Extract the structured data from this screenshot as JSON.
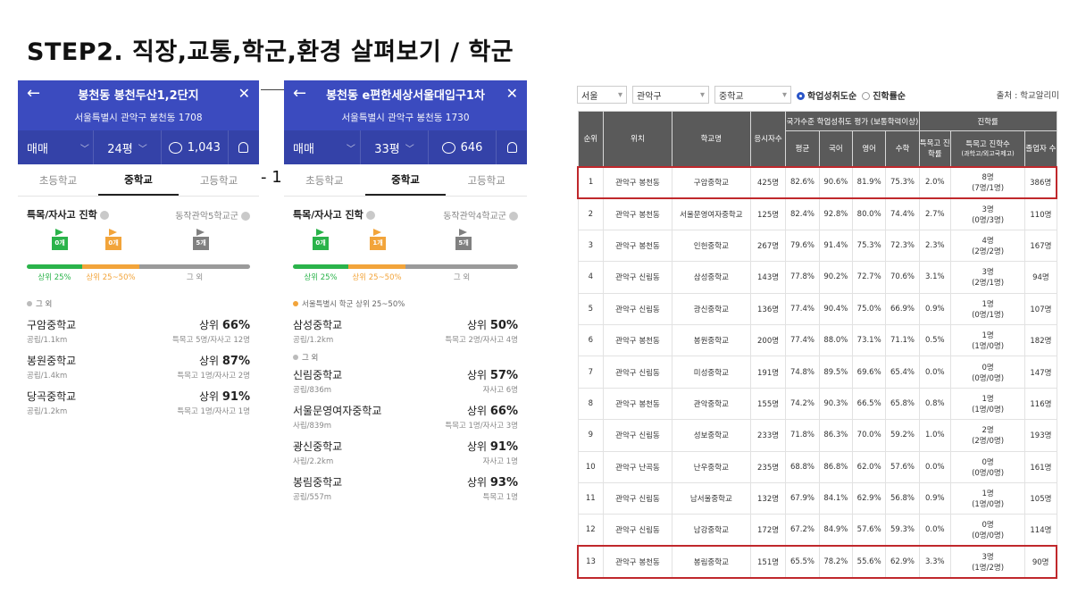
{
  "slide_title": "STEP2. 직장,교통,학군,환경 살펴보기 / 학군",
  "stray_text": "- 1",
  "panel1": {
    "title": "봉천동 봉천두산1,2단지",
    "address": "서울특별시 관악구 봉천동 1708",
    "trade": "매매",
    "size": "24평",
    "comments": "1,043",
    "tabs": [
      "초등학교",
      "중학교",
      "고등학교"
    ],
    "section_title": "특목/자사고 진학",
    "section_sub": "동작관악5학교군",
    "flags": [
      "0개",
      "0개",
      "5개"
    ],
    "bar_labels": [
      "상위 25%",
      "상위 25~50%",
      "그 외"
    ],
    "legend": "그 외",
    "schools": [
      {
        "name": "구암중학교",
        "rank_prefix": "상위",
        "rank": "66%",
        "type": "공립/1.1km",
        "detail": "특목고 5명/자사고 12명"
      },
      {
        "name": "봉원중학교",
        "rank_prefix": "상위",
        "rank": "87%",
        "type": "공립/1.4km",
        "detail": "특목고 1명/자사고 2명"
      },
      {
        "name": "당곡중학교",
        "rank_prefix": "상위",
        "rank": "91%",
        "type": "공립/1.2km",
        "detail": "특목고 1명/자사고 1명"
      }
    ]
  },
  "panel2": {
    "title": "봉천동 e편한세상서울대입구1차",
    "address": "서울특별시 관악구 봉천동 1730",
    "trade": "매매",
    "size": "33평",
    "comments": "646",
    "tabs": [
      "초등학교",
      "중학교",
      "고등학교"
    ],
    "section_title": "특목/자사고 진학",
    "section_sub": "동작관악4학교군",
    "flags": [
      "0개",
      "1개",
      "5개"
    ],
    "bar_labels": [
      "상위 25%",
      "상위 25~50%",
      "그 외"
    ],
    "legend_a": "서울특별시 학군 상위 25~50%",
    "legend_b": "그 외",
    "schools_a": [
      {
        "name": "삼성중학교",
        "rank_prefix": "상위",
        "rank": "50%",
        "type": "공립/1.2km",
        "detail": "특목고 2명/자사고 4명"
      }
    ],
    "schools_b": [
      {
        "name": "신림중학교",
        "rank_prefix": "상위",
        "rank": "57%",
        "type": "공립/836m",
        "detail": "자사고 6명"
      },
      {
        "name": "서울문영여자중학교",
        "rank_prefix": "상위",
        "rank": "66%",
        "type": "사립/839m",
        "detail": "특목고 1명/자사고 3명"
      },
      {
        "name": "광신중학교",
        "rank_prefix": "상위",
        "rank": "91%",
        "type": "사립/2.2km",
        "detail": "자사고 1명"
      },
      {
        "name": "봉림중학교",
        "rank_prefix": "상위",
        "rank": "93%",
        "type": "공립/557m",
        "detail": "특목고 1명"
      }
    ]
  },
  "filters": {
    "region": "서울",
    "district": "관악구",
    "level": "중학교",
    "radio_on": "학업성취도순",
    "radio_off": "진학률순",
    "source": "출처 : 학교알리미"
  },
  "table": {
    "h_rank": "순위",
    "h_loc": "위치",
    "h_school": "학교명",
    "h_students": "응시자수",
    "h_group1": "국가수준 학업성취도 평가 (보통학력이상)",
    "h_group2": "진학률",
    "h_avg": "평균",
    "h_kor": "국어",
    "h_eng": "영어",
    "h_math": "수학",
    "h_special_rate": "특목고 진학률",
    "h_special_cnt": "특목고 진학수",
    "h_special_cnt_sub": "(과학고/외고국제고)",
    "h_grads": "졸업자 수",
    "rows": [
      {
        "rank": "1",
        "loc": "관악구 봉천동",
        "school": "구암중학교",
        "students": "425명",
        "avg": "82.6%",
        "kor": "90.6%",
        "eng": "81.9%",
        "math": "75.3%",
        "rate": "2.0%",
        "cnt": "8명",
        "cnt_sub": "(7명/1명)",
        "grads": "386명"
      },
      {
        "rank": "2",
        "loc": "관악구 봉천동",
        "school": "서울문영여자중학교",
        "students": "125명",
        "avg": "82.4%",
        "kor": "92.8%",
        "eng": "80.0%",
        "math": "74.4%",
        "rate": "2.7%",
        "cnt": "3명",
        "cnt_sub": "(0명/3명)",
        "grads": "110명"
      },
      {
        "rank": "3",
        "loc": "관악구 봉천동",
        "school": "인헌중학교",
        "students": "267명",
        "avg": "79.6%",
        "kor": "91.4%",
        "eng": "75.3%",
        "math": "72.3%",
        "rate": "2.3%",
        "cnt": "4명",
        "cnt_sub": "(2명/2명)",
        "grads": "167명"
      },
      {
        "rank": "4",
        "loc": "관악구 신림동",
        "school": "삼성중학교",
        "students": "143명",
        "avg": "77.8%",
        "kor": "90.2%",
        "eng": "72.7%",
        "math": "70.6%",
        "rate": "3.1%",
        "cnt": "3명",
        "cnt_sub": "(2명/1명)",
        "grads": "94명"
      },
      {
        "rank": "5",
        "loc": "관악구 신림동",
        "school": "광신중학교",
        "students": "136명",
        "avg": "77.4%",
        "kor": "90.4%",
        "eng": "75.0%",
        "math": "66.9%",
        "rate": "0.9%",
        "cnt": "1명",
        "cnt_sub": "(0명/1명)",
        "grads": "107명"
      },
      {
        "rank": "6",
        "loc": "관악구 봉천동",
        "school": "봉원중학교",
        "students": "200명",
        "avg": "77.4%",
        "kor": "88.0%",
        "eng": "73.1%",
        "math": "71.1%",
        "rate": "0.5%",
        "cnt": "1명",
        "cnt_sub": "(1명/0명)",
        "grads": "182명"
      },
      {
        "rank": "7",
        "loc": "관악구 신림동",
        "school": "미성중학교",
        "students": "191명",
        "avg": "74.8%",
        "kor": "89.5%",
        "eng": "69.6%",
        "math": "65.4%",
        "rate": "0.0%",
        "cnt": "0명",
        "cnt_sub": "(0명/0명)",
        "grads": "147명"
      },
      {
        "rank": "8",
        "loc": "관악구 봉천동",
        "school": "관악중학교",
        "students": "155명",
        "avg": "74.2%",
        "kor": "90.3%",
        "eng": "66.5%",
        "math": "65.8%",
        "rate": "0.8%",
        "cnt": "1명",
        "cnt_sub": "(1명/0명)",
        "grads": "116명"
      },
      {
        "rank": "9",
        "loc": "관악구 신림동",
        "school": "성보중학교",
        "students": "233명",
        "avg": "71.8%",
        "kor": "86.3%",
        "eng": "70.0%",
        "math": "59.2%",
        "rate": "1.0%",
        "cnt": "2명",
        "cnt_sub": "(2명/0명)",
        "grads": "193명"
      },
      {
        "rank": "10",
        "loc": "관악구 난곡동",
        "school": "난우중학교",
        "students": "235명",
        "avg": "68.8%",
        "kor": "86.8%",
        "eng": "62.0%",
        "math": "57.6%",
        "rate": "0.0%",
        "cnt": "0명",
        "cnt_sub": "(0명/0명)",
        "grads": "161명"
      },
      {
        "rank": "11",
        "loc": "관악구 신림동",
        "school": "남서울중학교",
        "students": "132명",
        "avg": "67.9%",
        "kor": "84.1%",
        "eng": "62.9%",
        "math": "56.8%",
        "rate": "0.9%",
        "cnt": "1명",
        "cnt_sub": "(1명/0명)",
        "grads": "105명"
      },
      {
        "rank": "12",
        "loc": "관악구 신림동",
        "school": "남강중학교",
        "students": "172명",
        "avg": "67.2%",
        "kor": "84.9%",
        "eng": "57.6%",
        "math": "59.3%",
        "rate": "0.0%",
        "cnt": "0명",
        "cnt_sub": "(0명/0명)",
        "grads": "114명"
      },
      {
        "rank": "13",
        "loc": "관악구 봉천동",
        "school": "봉림중학교",
        "students": "151명",
        "avg": "65.5%",
        "kor": "78.2%",
        "eng": "55.6%",
        "math": "62.9%",
        "rate": "3.3%",
        "cnt": "3명",
        "cnt_sub": "(1명/2명)",
        "grads": "90명"
      }
    ]
  },
  "colors": {
    "header_blue": "#3b4bbf",
    "green": "#2ab34a",
    "orange": "#f2a43a",
    "gray": "#9a9a9a",
    "highlight": "#c0282c"
  }
}
